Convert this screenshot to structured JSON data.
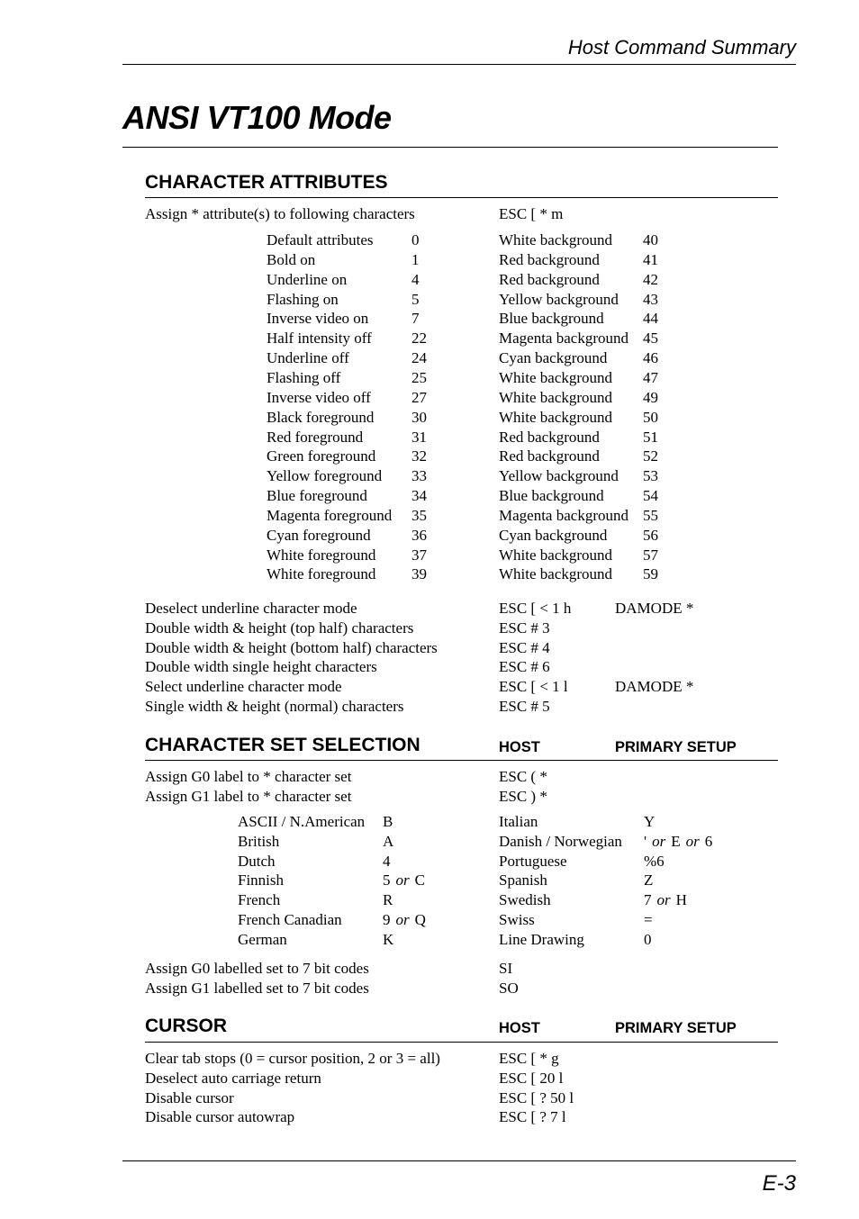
{
  "header": {
    "running_title": "Host Command Summary"
  },
  "page_title": "ANSI VT100 Mode",
  "character_attributes": {
    "heading": "CHARACTER ATTRIBUTES",
    "assign": {
      "description": "Assign * attribute(s) to following characters",
      "host": "ESC [ * m"
    },
    "left_attributes": [
      {
        "name": "Default attributes",
        "code": "0"
      },
      {
        "name": "Bold on",
        "code": "1"
      },
      {
        "name": "Underline on",
        "code": "4"
      },
      {
        "name": "Flashing on",
        "code": "5"
      },
      {
        "name": "Inverse video on",
        "code": "7"
      },
      {
        "name": "Half intensity off",
        "code": "22"
      },
      {
        "name": "Underline off",
        "code": "24"
      },
      {
        "name": "Flashing off",
        "code": "25"
      },
      {
        "name": "Inverse video off",
        "code": "27"
      },
      {
        "name": "Black foreground",
        "code": "30"
      },
      {
        "name": "Red foreground",
        "code": "31"
      },
      {
        "name": "Green foreground",
        "code": "32"
      },
      {
        "name": "Yellow foreground",
        "code": "33"
      },
      {
        "name": "Blue foreground",
        "code": "34"
      },
      {
        "name": "Magenta foreground",
        "code": "35"
      },
      {
        "name": "Cyan foreground",
        "code": "36"
      },
      {
        "name": "White foreground",
        "code": "37"
      },
      {
        "name": "White foreground",
        "code": "39"
      }
    ],
    "right_attributes": [
      {
        "name": "White background",
        "code": "40"
      },
      {
        "name": "Red background",
        "code": "41"
      },
      {
        "name": "Red background",
        "code": "42"
      },
      {
        "name": "Yellow background",
        "code": "43"
      },
      {
        "name": "Blue background",
        "code": "44"
      },
      {
        "name": "Magenta background",
        "code": "45"
      },
      {
        "name": "Cyan background",
        "code": "46"
      },
      {
        "name": "White background",
        "code": "47"
      },
      {
        "name": "White background",
        "code": "49"
      },
      {
        "name": "White background",
        "code": "50"
      },
      {
        "name": "Red background",
        "code": "51"
      },
      {
        "name": "Red background",
        "code": "52"
      },
      {
        "name": "Yellow background",
        "code": "53"
      },
      {
        "name": "Blue background",
        "code": "54"
      },
      {
        "name": "Magenta background",
        "code": "55"
      },
      {
        "name": "Cyan background",
        "code": "56"
      },
      {
        "name": "White background",
        "code": "57"
      },
      {
        "name": "White background",
        "code": "59"
      }
    ],
    "commands": [
      {
        "description": "Deselect underline character mode",
        "host": "ESC [ < 1 h",
        "setup": "DAMODE *"
      },
      {
        "description": "Double width & height (top half) characters",
        "host": "ESC # 3",
        "setup": ""
      },
      {
        "description": "Double width & height (bottom half) characters",
        "host": "ESC # 4",
        "setup": ""
      },
      {
        "description": "Double width single height characters",
        "host": "ESC # 6",
        "setup": ""
      },
      {
        "description": "Select underline character mode",
        "host": "ESC [ < 1 l",
        "setup": "DAMODE *"
      },
      {
        "description": "Single width & height (normal) characters",
        "host": "ESC # 5",
        "setup": ""
      }
    ]
  },
  "character_set_selection": {
    "heading": "CHARACTER SET SELECTION",
    "host_label": "HOST",
    "setup_label": "PRIMARY SETUP",
    "assign_commands": [
      {
        "description": "Assign G0 label to * character set",
        "host": "ESC ( *"
      },
      {
        "description": "Assign G1 label to * character set",
        "host": "ESC ) *"
      }
    ],
    "left_sets": [
      {
        "name": "ASCII / N.American",
        "code": "B"
      },
      {
        "name": "British",
        "code": "A"
      },
      {
        "name": "Dutch",
        "code": "4"
      },
      {
        "name": "Finnish",
        "code_parts": [
          "5",
          "or",
          "C"
        ]
      },
      {
        "name": "French",
        "code": "R"
      },
      {
        "name": "French Canadian",
        "code_parts": [
          "9",
          "or",
          "Q"
        ]
      },
      {
        "name": "German",
        "code": "K"
      }
    ],
    "right_sets": [
      {
        "name": "Italian",
        "code": "Y"
      },
      {
        "name": "Danish / Norwegian",
        "code_parts": [
          "'",
          "or",
          "E",
          "or",
          "6"
        ]
      },
      {
        "name": "Portuguese",
        "code": "%6"
      },
      {
        "name": "Spanish",
        "code": "Z"
      },
      {
        "name": "Swedish",
        "code_parts": [
          "7",
          "or",
          "H"
        ]
      },
      {
        "name": "Swiss",
        "code": "="
      },
      {
        "name": "Line Drawing",
        "code": "0"
      }
    ],
    "shift_commands": [
      {
        "description": "Assign G0 labelled set to 7 bit codes",
        "host": "SI"
      },
      {
        "description": "Assign G1 labelled set to 7 bit codes",
        "host": "SO"
      }
    ]
  },
  "cursor": {
    "heading": "CURSOR",
    "host_label": "HOST",
    "setup_label": "PRIMARY SETUP",
    "commands": [
      {
        "description": "Clear tab stops (0 = cursor position, 2 or 3 = all)",
        "host": "ESC [ * g"
      },
      {
        "description": "Deselect auto carriage return",
        "host": "ESC [ 20 l"
      },
      {
        "description": "Disable cursor",
        "host": "ESC [ ? 50 l"
      },
      {
        "description": "Disable cursor autowrap",
        "host": "ESC [ ? 7 l"
      }
    ]
  },
  "footer": {
    "page_number": "E-3"
  }
}
